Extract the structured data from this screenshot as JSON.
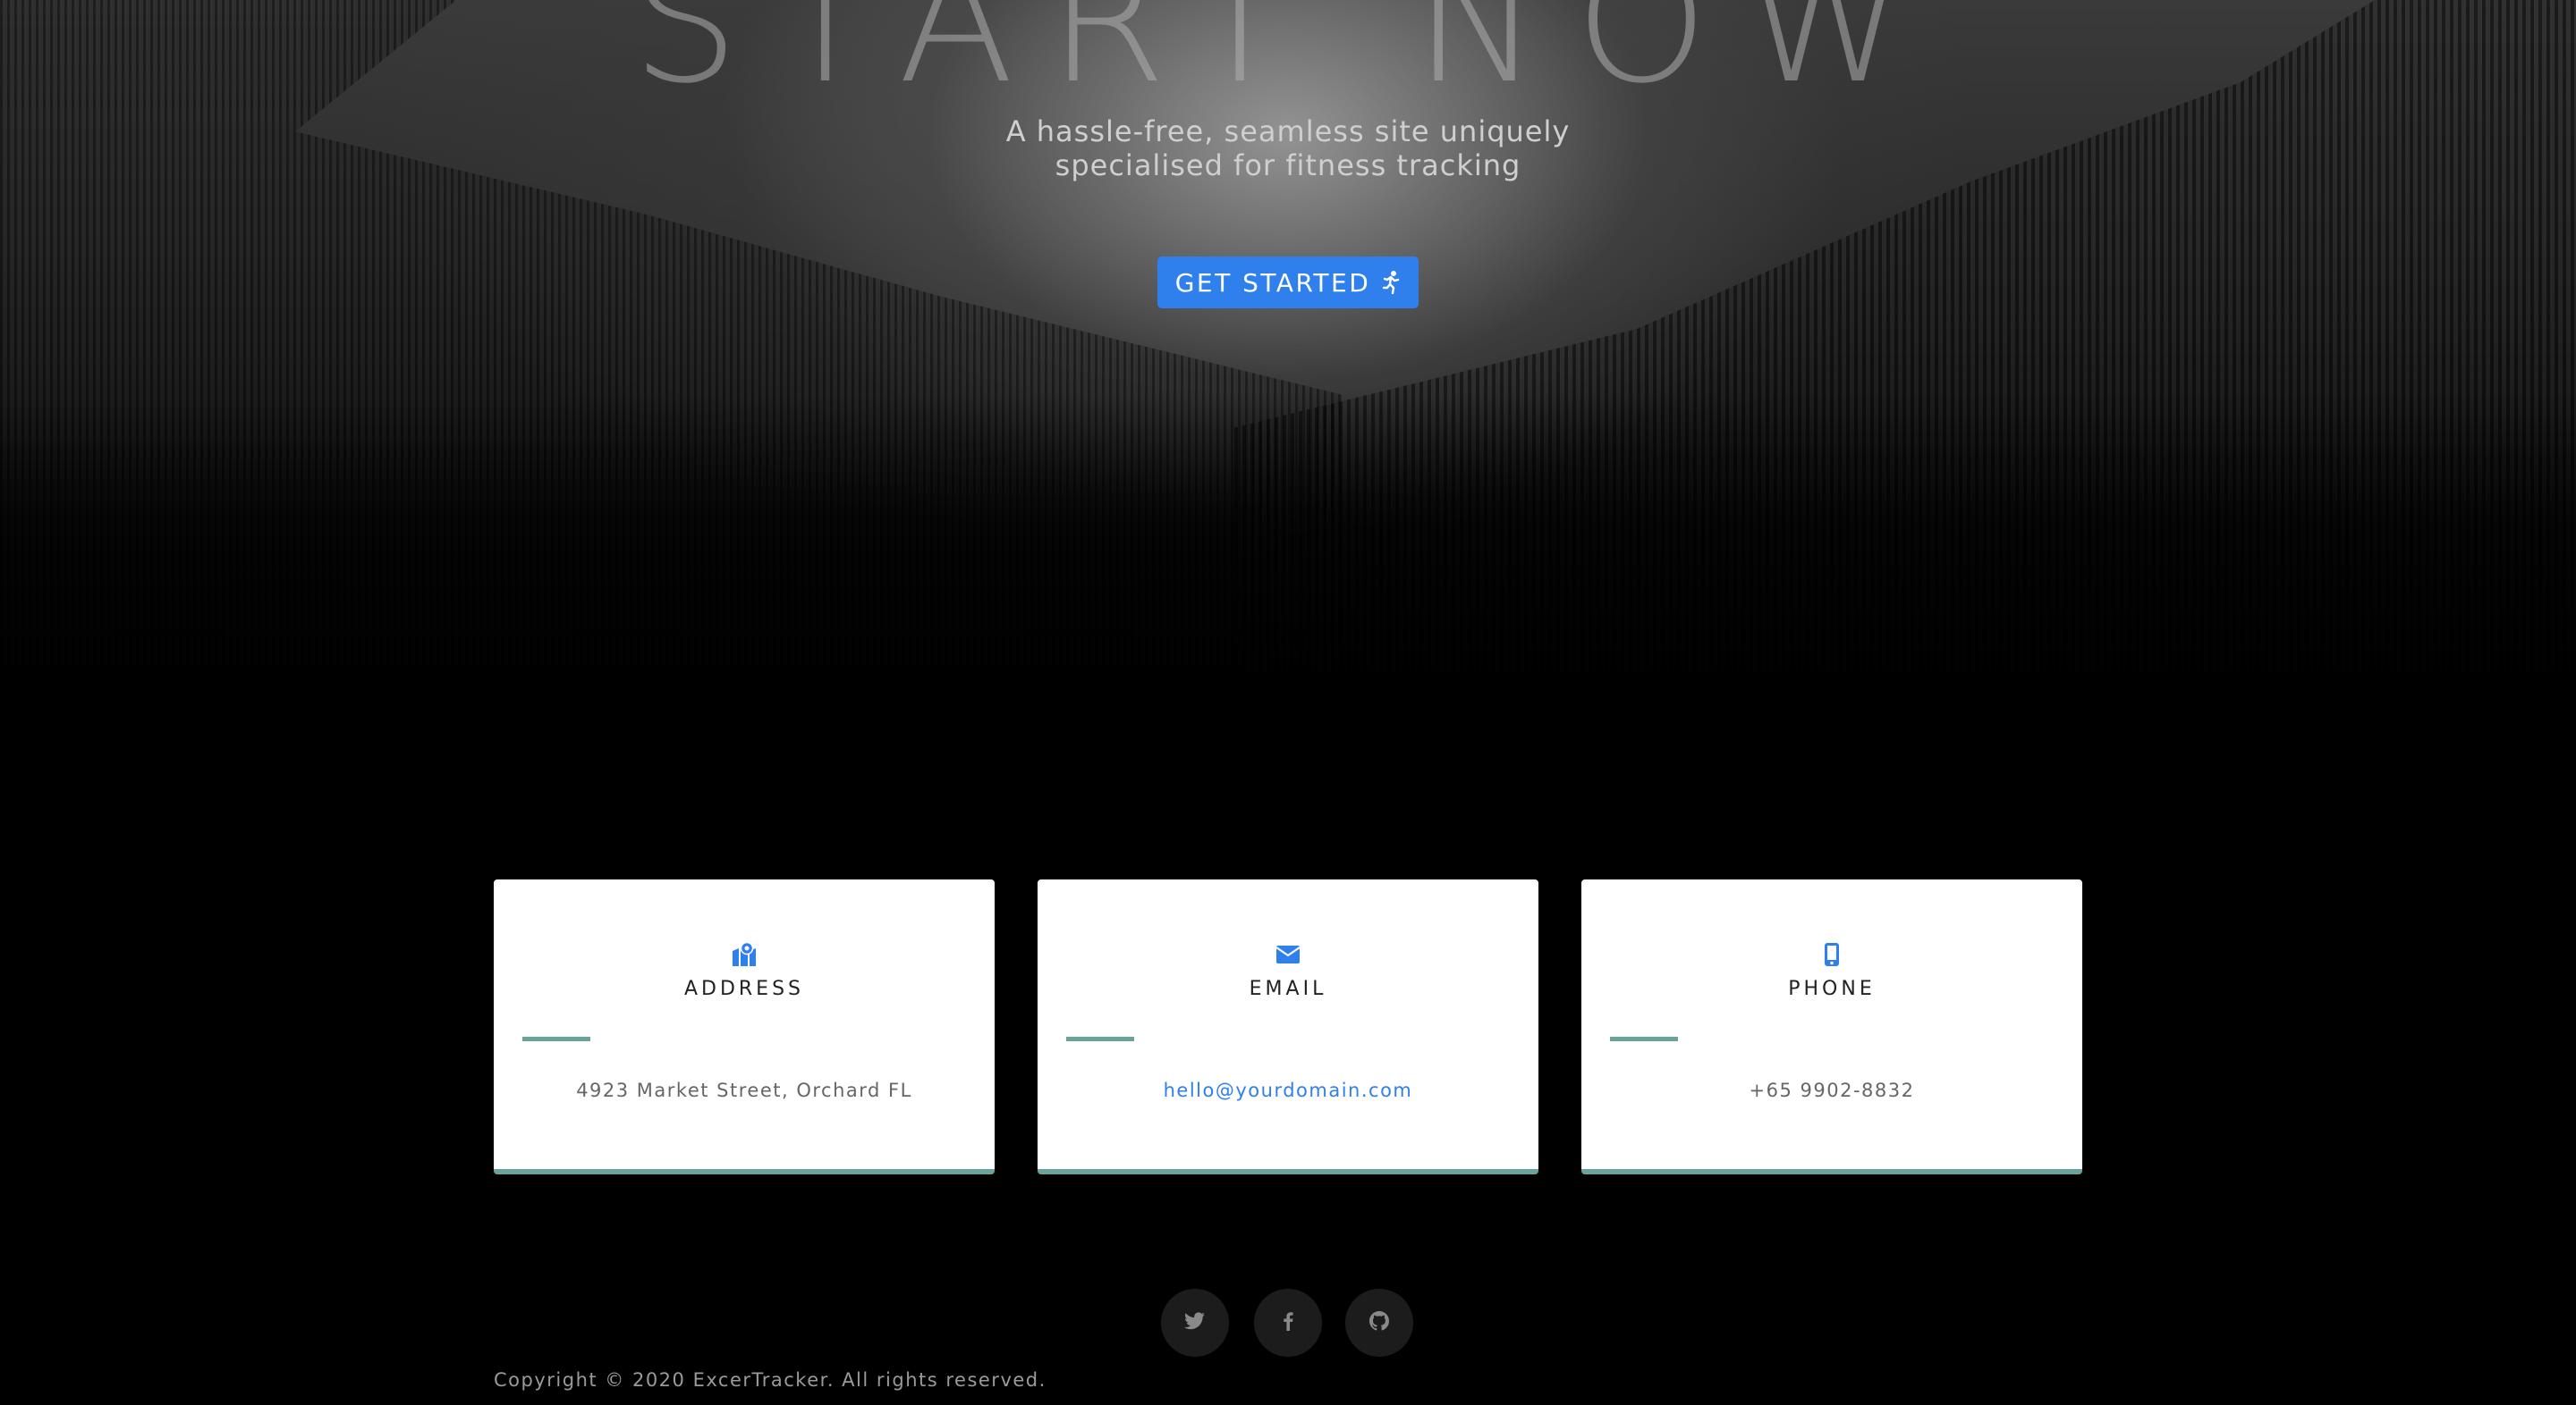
{
  "hero": {
    "title": "START NOW",
    "subtitle": "A hassle-free, seamless site uniquely specialised for fitness tracking",
    "cta_label": "GET STARTED",
    "cta_icon": "running-icon"
  },
  "contact_cards": [
    {
      "icon": "map-marker-icon",
      "title": "ADDRESS",
      "value": "4923 Market Street, Orchard FL"
    },
    {
      "icon": "envelope-icon",
      "title": "EMAIL",
      "value": "hello@yourdomain.com"
    },
    {
      "icon": "mobile-phone-icon",
      "title": "PHONE",
      "value": "+65 9902-8832"
    }
  ],
  "social": [
    {
      "icon": "twitter-icon"
    },
    {
      "icon": "facebook-icon"
    },
    {
      "icon": "github-icon"
    }
  ],
  "footer": {
    "copyright": "Copyright © 2020 ExcerTracker. All rights reserved."
  },
  "colors": {
    "accent": "#2f80ed",
    "card_rule": "#6aa39a",
    "background": "#000000"
  }
}
